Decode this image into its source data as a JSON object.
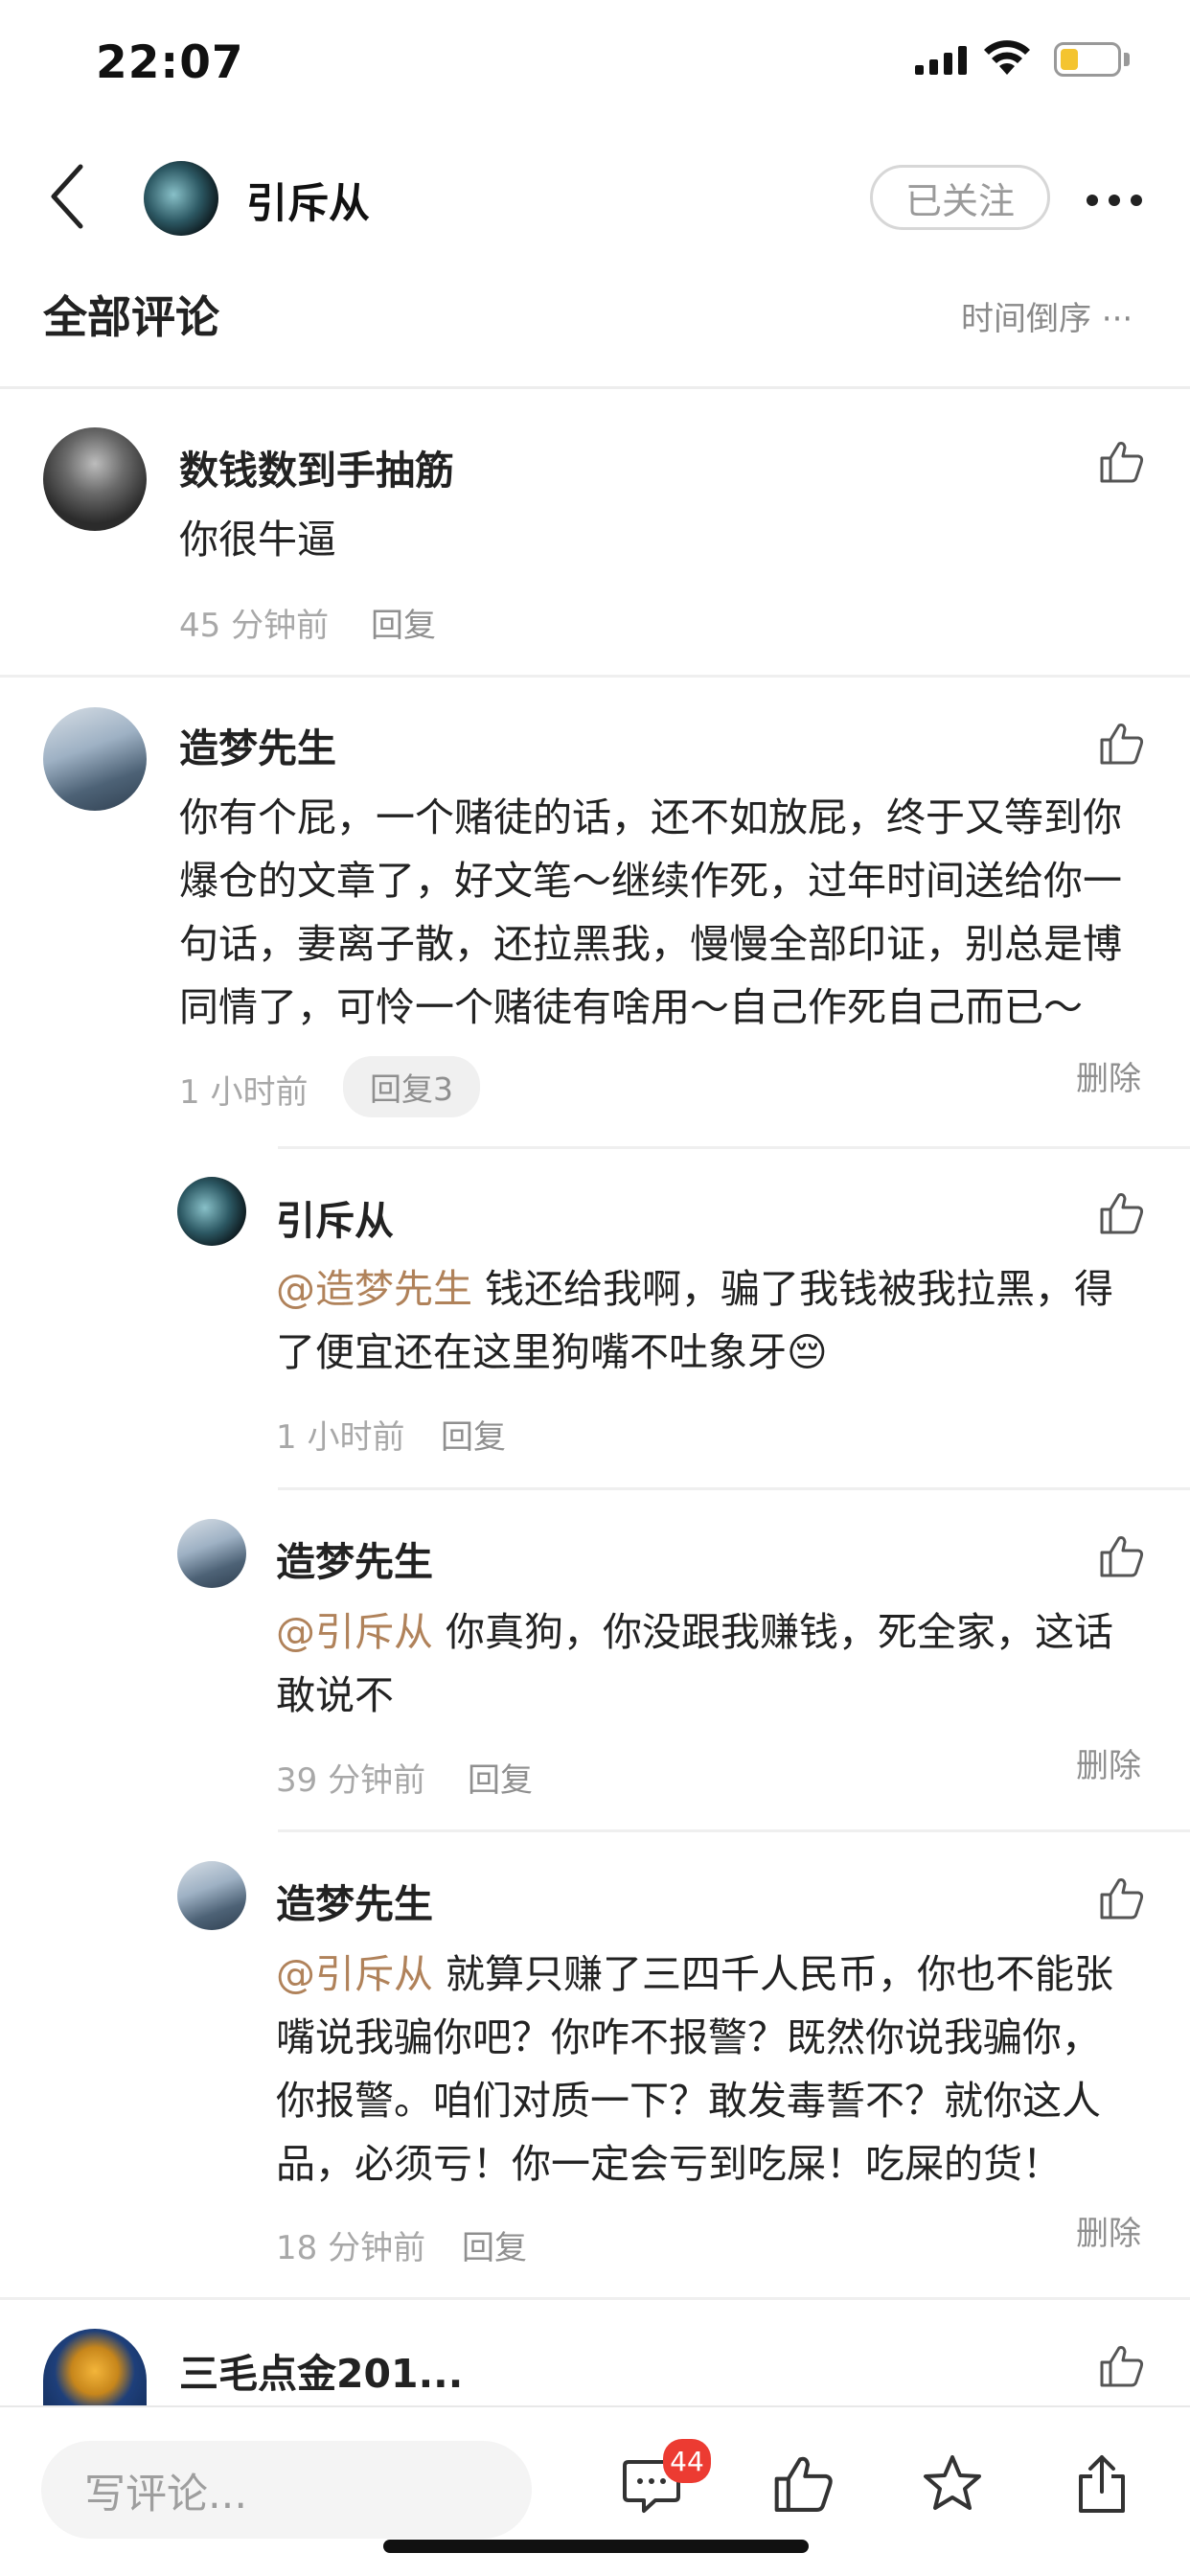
{
  "status_bar": {
    "time": "22:07"
  },
  "header": {
    "title": "引斥从",
    "follow_label": "已关注"
  },
  "section": {
    "title": "全部评论",
    "sort_label": "时间倒序 ···"
  },
  "comments": [
    {
      "author": "数钱数到手抽筋",
      "text": "你很牛逼",
      "time": "45 分钟前",
      "reply_label": "回复"
    },
    {
      "author": "造梦先生",
      "lines": [
        "你有个屁，一个赌徒的话，还不如放屁，终于又等到你",
        "爆仓的文章了，好文笔～继续作死，过年时间送给你一",
        "句话，妻离子散，还拉黑我，慢慢全部印证，别总是博",
        "同情了，可怜一个赌徒有啥用～自己作死自己而已～"
      ],
      "time": "1 小时前",
      "reply_count_label": "回复3",
      "delete_label": "删除",
      "replies": [
        {
          "author": "引斥从",
          "mention": "@造梦先生",
          "line1": " 钱还给我啊，骗了我钱被我拉黑，得",
          "line2": "了便宜还在这里狗嘴不吐象牙😔",
          "time": "1 小时前",
          "reply_label": "回复"
        },
        {
          "author": "造梦先生",
          "mention": "@引斥从",
          "line1": " 你真狗，你没跟我赚钱，死全家，这话",
          "line2": "敢说不",
          "time": "39 分钟前",
          "reply_label": "回复",
          "delete_label": "删除"
        },
        {
          "author": "造梦先生",
          "mention": "@引斥从",
          "line1": " 就算只赚了三四千人民币，你也不能张",
          "line2": "嘴说我骗你吧？你咋不报警？既然你说我骗你，",
          "line3": "你报警。咱们对质一下？敢发毒誓不？就你这人",
          "line4": "品，必须亏！你一定会亏到吃屎！吃屎的货！",
          "time": "18 分钟前",
          "reply_label": "回复",
          "delete_label": "删除"
        }
      ]
    },
    {
      "author": "三毛点金201..."
    }
  ],
  "bottom_bar": {
    "write_placeholder": "写评论...",
    "comment_count": "44"
  },
  "colors": {
    "mention": "#b0825a",
    "badge": "#ec3b32",
    "battery": "#f4c430"
  },
  "icons": [
    "back-icon",
    "more-icon",
    "like-icon",
    "comment-icon",
    "star-icon",
    "share-icon",
    "signal-icon",
    "wifi-icon",
    "battery-icon"
  ]
}
